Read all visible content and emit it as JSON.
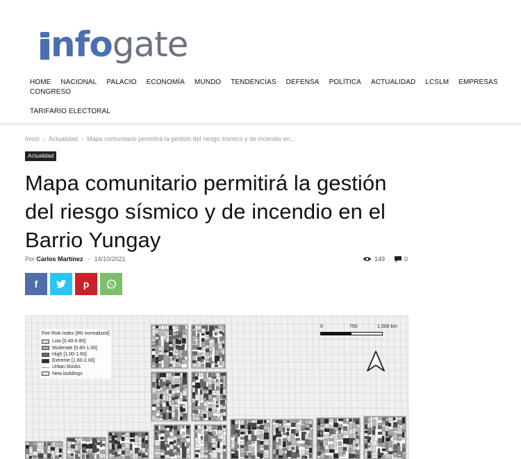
{
  "logo": {
    "blue": "nfo",
    "gray": "gate"
  },
  "nav": {
    "row1": [
      "HOME",
      "NACIONAL",
      "PALACIO",
      "ECONOMÍA",
      "MUNDO",
      "TENDENCIAS",
      "DEFENSA",
      "POLÍTICA",
      "ACTUALIDAD",
      "LCSLM",
      "EMPRESAS",
      "CONGRESO"
    ],
    "row2": [
      "TARIFARIO ELECTORAL"
    ]
  },
  "breadcrumb": {
    "home": "Inicio",
    "section": "Actualidad",
    "current": "Mapa comunitario permitirá la gestión del riesgo sísmico y de incendio en...",
    "separator": "›"
  },
  "article": {
    "category": "Actualidad",
    "title": "Mapa comunitario permitirá la gestión del riesgo sísmico y de incendio en el Barrio Yungay",
    "by": "Por",
    "author": "Carlos Martínez",
    "dash": "-",
    "date": "14/10/2021",
    "views": "149",
    "comments": "0"
  },
  "share": {
    "facebook": "f",
    "twitter": "twitter-icon",
    "pinterest": "p",
    "whatsapp": "whatsapp-icon"
  },
  "map": {
    "legend_title": "Fire Risk Index [IRI normalized]",
    "legend": [
      {
        "label": "Low [0.40-0.80]",
        "color": "#d9d9d9"
      },
      {
        "label": "Moderate [0.80-1.00]",
        "color": "#a6a6a6"
      },
      {
        "label": "High [1.00-1.60]",
        "color": "#6b6b6b"
      },
      {
        "label": "Extreme [1.60-2.00]",
        "color": "#2b2b2b"
      }
    ],
    "legend_line": "Urban blocks",
    "legend_new": "New buildings",
    "scale": [
      "0",
      "750",
      "1,500 km"
    ]
  },
  "colors": {
    "brand_blue": "#4a6fb3",
    "brand_gray": "#6b7280"
  }
}
